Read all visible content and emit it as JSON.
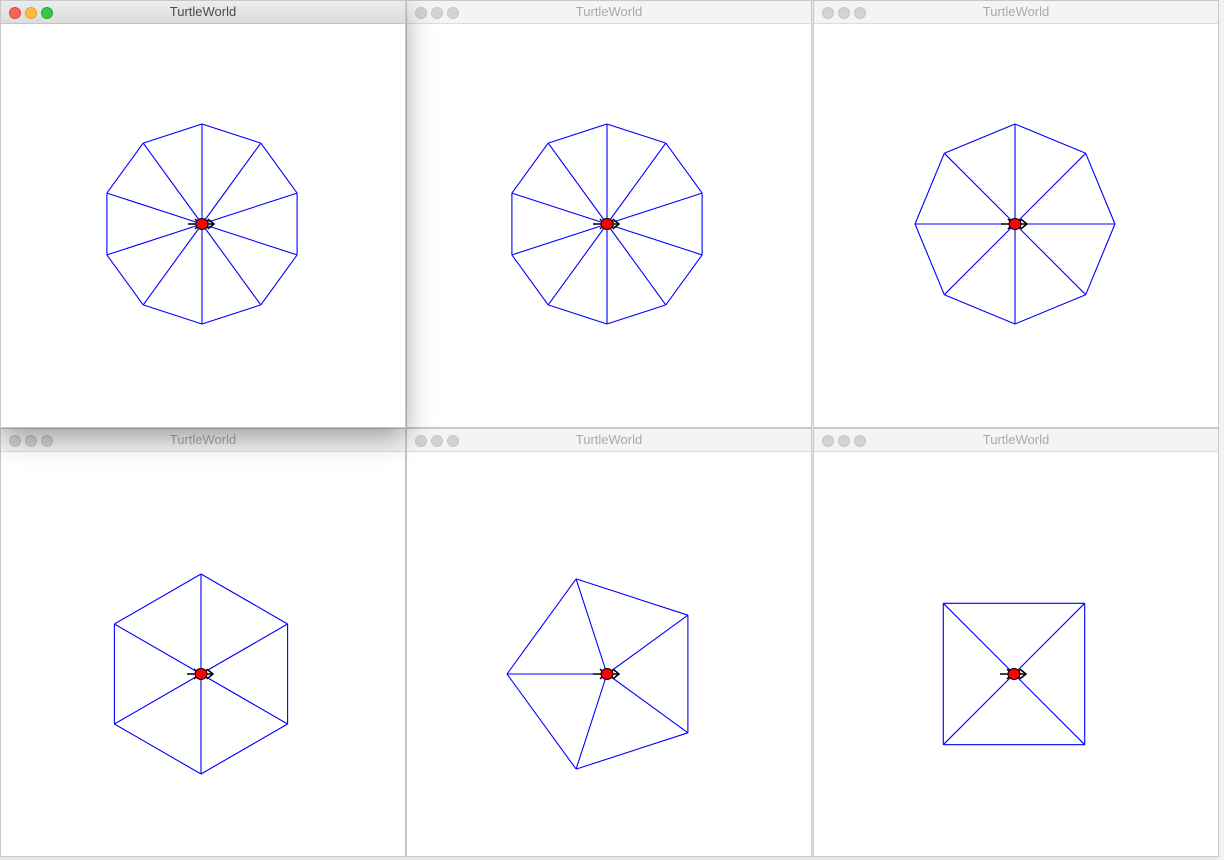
{
  "windows": [
    {
      "title": "TurtleWorld",
      "active": true,
      "sides": 10
    },
    {
      "title": "TurtleWorld",
      "active": false,
      "sides": 10
    },
    {
      "title": "TurtleWorld",
      "active": false,
      "sides": 8
    },
    {
      "title": "TurtleWorld",
      "active": false,
      "sides": 6
    },
    {
      "title": "TurtleWorld",
      "active": false,
      "sides": 5
    },
    {
      "title": "TurtleWorld",
      "active": false,
      "sides": 4
    }
  ],
  "colors": {
    "polygon_line": "#0000ff",
    "turtle_body": "#ff0000",
    "turtle_outline": "#000000"
  },
  "icons": {
    "close": "close-icon",
    "minimize": "minimize-icon",
    "zoom": "zoom-icon",
    "turtle": "turtle-icon"
  }
}
